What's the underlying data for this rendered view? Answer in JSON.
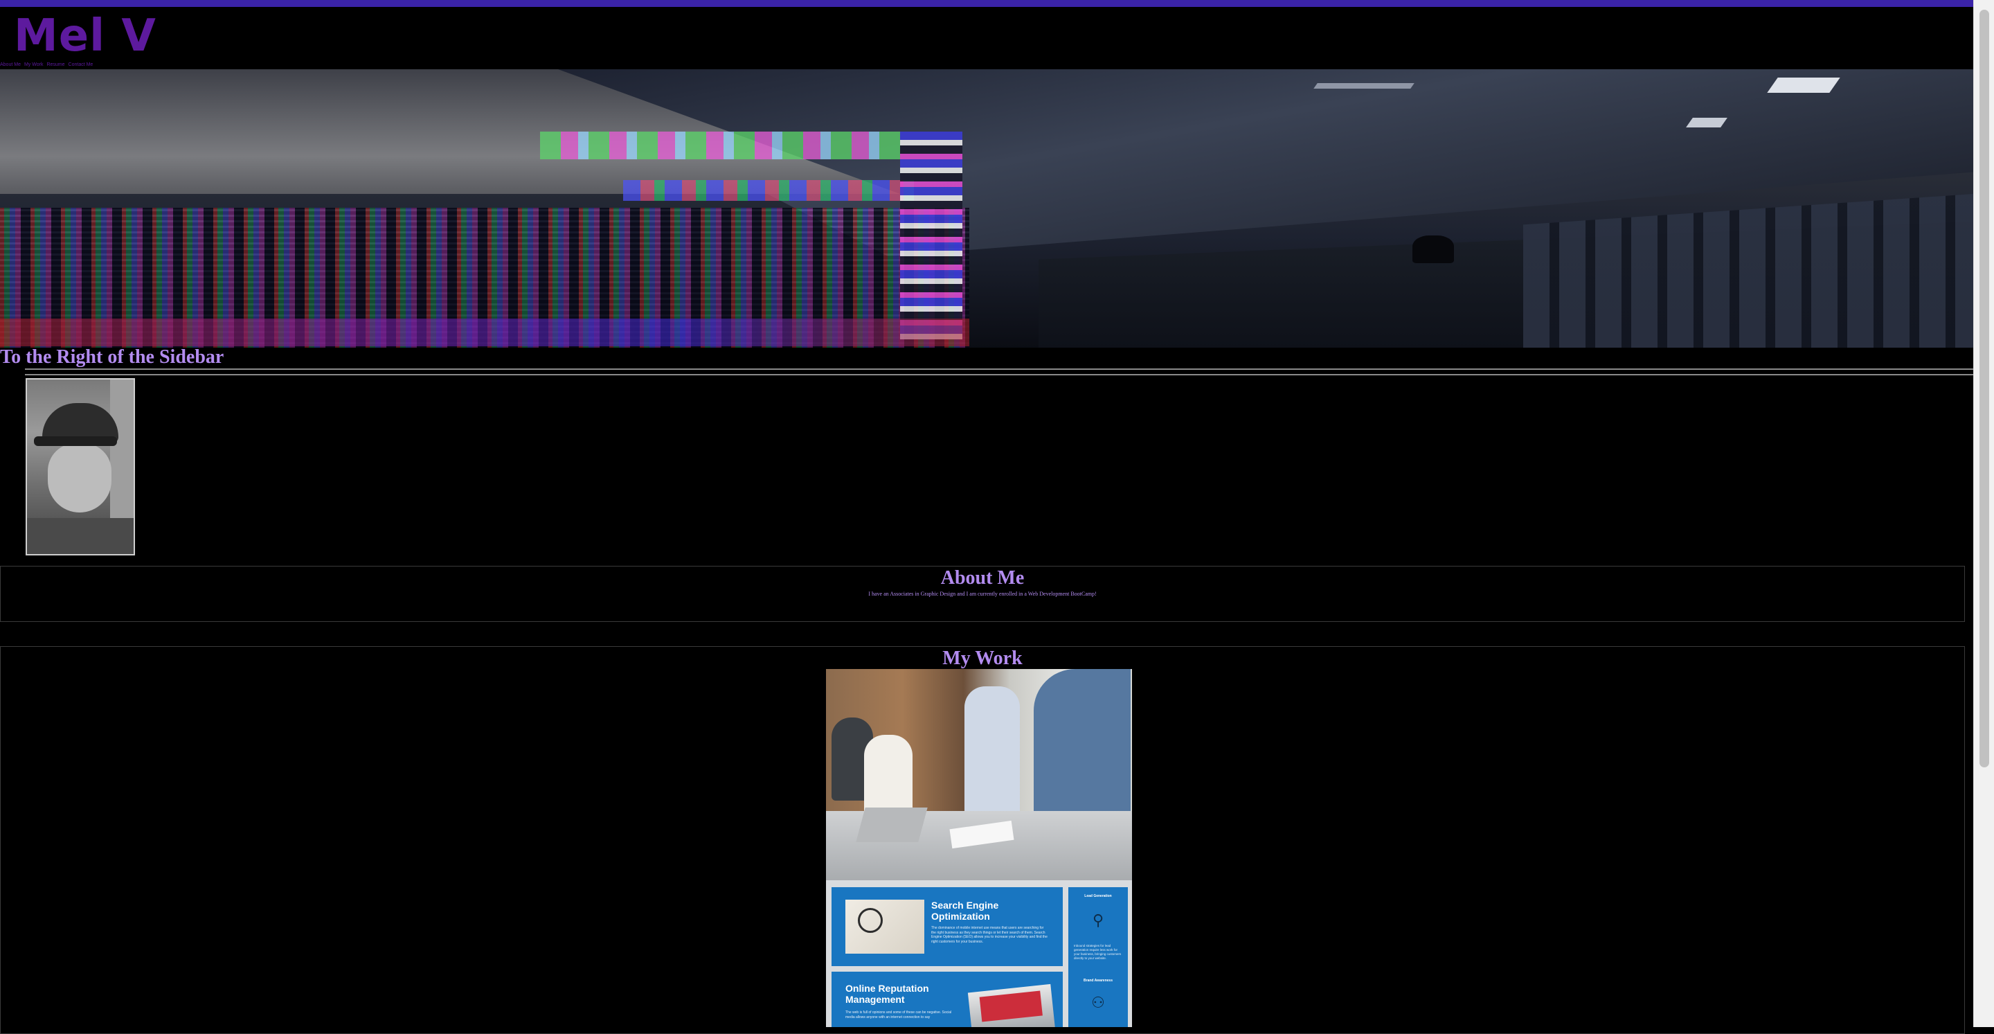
{
  "site": {
    "logo": "Mel V"
  },
  "nav": {
    "items": [
      "About Me",
      "My Work",
      "Resume",
      "Contact Me"
    ]
  },
  "sidebar": {
    "heading": "To the Right of the Sidebar"
  },
  "about": {
    "heading": "About Me",
    "text": "I have an Associates in Graphic Design and I am currently enrolled in a Web Development BootCamp!"
  },
  "work": {
    "heading": "My Work",
    "card": {
      "seo_title": "Search Engine Optimization",
      "seo_text": "The dominance of mobile internet use means that users are searching for the right business as they search things or let their search of them. Search Engine Optimization (SEO) allows you to increase your visibility and find the right customers for your business.",
      "orm_title": "Online Reputation Management",
      "orm_text": "The web is full of opinions and some of these can be negative. Social media allows anyone with an internet connection to say",
      "lead_title": "Lead Generation",
      "lead_text": "Inbound strategies for lead generation require less work for your business, bringing customers directly to your website.",
      "brand_title": "Brand Awareness"
    }
  },
  "colors": {
    "topbar": "#3a23a8",
    "logo": "#5d1a9e",
    "heading": "#b38cf0",
    "card_blue": "#1976c1"
  }
}
